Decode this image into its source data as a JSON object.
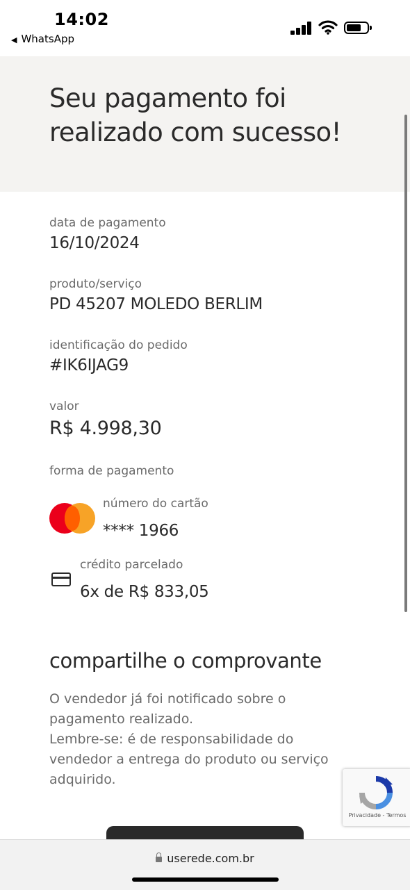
{
  "status_bar": {
    "time": "14:02",
    "back_app": "WhatsApp",
    "back_icon": "back-triangle-icon",
    "icons": [
      "cellular-signal-icon",
      "wifi-icon",
      "battery-icon"
    ]
  },
  "header": {
    "title": "Seu pagamento foi realizado com sucesso!"
  },
  "details": {
    "payment_date_label": "data de pagamento",
    "payment_date": "16/10/2024",
    "product_label": "produto/serviço",
    "product": "PD 45207 MOLEDO BERLIM",
    "order_id_label": "identificação do pedido",
    "order_id": "#IK6IJAG9",
    "amount_label": "valor",
    "amount": "R$ 4.998,30",
    "payment_method_label": "forma de pagamento",
    "card_number_label": "número do cartão",
    "card_number": "**** 1966",
    "card_brand_icon": "mastercard-logo-icon",
    "installment_label": "crédito parcelado",
    "installments": "6x de R$ 833,05",
    "installment_icon": "credit-card-icon"
  },
  "share": {
    "title": "compartilhe o comprovante",
    "notice_line1": "O vendedor já foi notificado sobre o pagamento realizado.",
    "notice_line2": "Lembre-se: é de responsabilidade do vendedor a entrega do produto ou serviço adquirido."
  },
  "recaptcha": {
    "text": "Privacidade - Termos",
    "icon": "recaptcha-icon"
  },
  "browser": {
    "url": "userede.com.br",
    "lock_icon": "lock-icon"
  },
  "colors": {
    "header_bg": "#f4f3f1",
    "text_dark": "#2a2a2a",
    "text_muted": "#6a6a6a",
    "mastercard_red": "#eb001b",
    "mastercard_orange": "#f79e1b"
  }
}
